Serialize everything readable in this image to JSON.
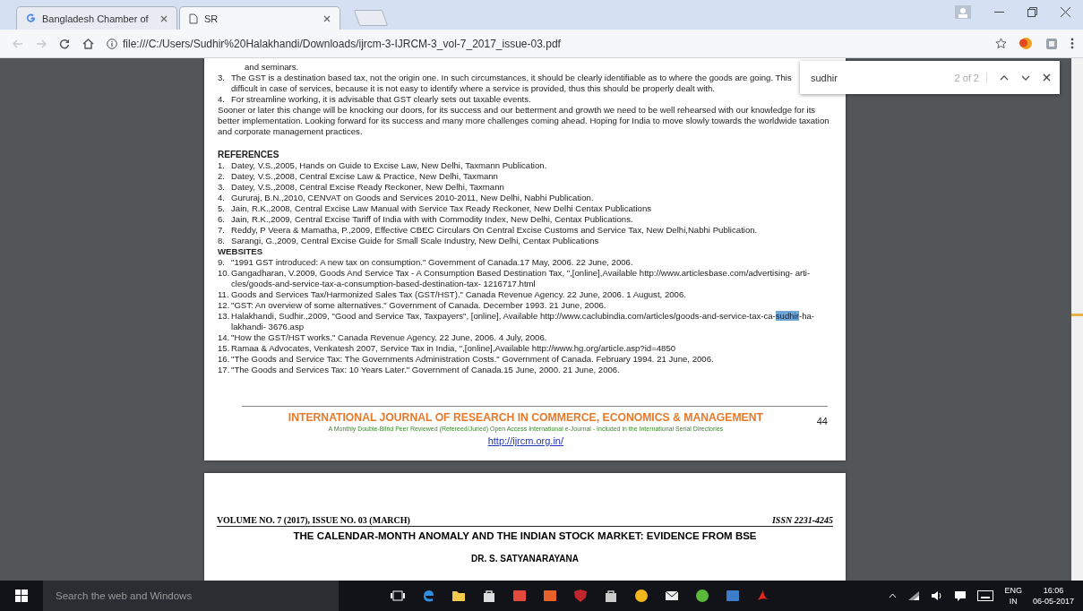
{
  "tabs": [
    {
      "title": "Bangladesh Chamber of",
      "selected": false
    },
    {
      "title": "SR",
      "selected": true
    }
  ],
  "address_bar": {
    "url": "file:///C:/Users/Sudhir%20Halakhandi/Downloads/ijrcm-3-IJRCM-3_vol-7_2017_issue-03.pdf",
    "back_disabled": true,
    "forward_disabled": true
  },
  "find_bar": {
    "query": "sudhir",
    "count": "2 of 2"
  },
  "page_1": {
    "blocks": [
      {
        "kind": "line",
        "lines": [
          "and seminars."
        ]
      },
      {
        "kind": "item",
        "number": "3.",
        "lines": [
          "The GST is a destination based tax, not the origin one. In such circumstances, it should be clearly identifiable as to where the goods are going. This",
          "difficult in case of services, because it is not easy to identify where a service is provided, thus this should be properly dealt with."
        ]
      },
      {
        "kind": "item",
        "number": "4.",
        "lines": [
          "For streamline working, it is advisable that GST clearly sets out taxable events."
        ]
      },
      {
        "kind": "paragraph",
        "lines": [
          "Sooner or later this change will be knocking our doors, for its success and our betterment and growth we need to be well rehearsed with our knowledge for its",
          "better implementation. Looking forward for its success and many more challenges coming ahead. Hoping for India to move slowly towards the worldwide taxation",
          "and corporate management practices."
        ]
      },
      {
        "kind": "heading",
        "lines": [
          "REFERENCES"
        ]
      },
      {
        "kind": "item",
        "number": "1.",
        "lines": [
          "Datey, V.S.,2005, Hands on Guide to Excise Law, New Delhi, Taxmann Publication."
        ]
      },
      {
        "kind": "item",
        "number": "2.",
        "lines": [
          "Datey, V.S.,2008, Central Excise Law & Practice, New Delhi, Taxmann"
        ]
      },
      {
        "kind": "item",
        "number": "3.",
        "lines": [
          "Datey, V.S.,2008, Central Excise Ready Reckoner, New Delhi, Taxmann"
        ]
      },
      {
        "kind": "item",
        "number": "4.",
        "lines": [
          "Gururaj, B.N.,2010, CENVAT on Goods and Services 2010-2011, New Delhi, Nabhi Publication."
        ]
      },
      {
        "kind": "item",
        "number": "5.",
        "lines": [
          "Jain, R.K.,2008, Central Excise Law Manual with Service Tax Ready Reckoner, New Delhi Centax Publications"
        ]
      },
      {
        "kind": "item",
        "number": "6.",
        "lines": [
          "Jain, R.K.,2009, Central Excise Tariff of India with with Commodity Index, New Delhi, Centax Publications."
        ]
      },
      {
        "kind": "item",
        "number": "7.",
        "lines": [
          "Reddy, P Veera & Mamatha, P.,2009, Effective CBEC Circulars On Central Excise Customs and Service Tax, New Delhi,Nabhi Publication."
        ]
      },
      {
        "kind": "item",
        "number": "8.",
        "lines": [
          "Sarangi, G.,2009, Central Excise Guide for Small Scale Industry, New Delhi, Centax Publications"
        ]
      },
      {
        "kind": "subheading",
        "lines": [
          "WEBSITES"
        ]
      },
      {
        "kind": "item",
        "number": "9.",
        "lines": [
          "\"1991 GST introduced: A new tax on consumption.\" Government of Canada.17 May, 2006. 22 June, 2006."
        ]
      },
      {
        "kind": "item",
        "number": "10.",
        "lines": [
          "Gangadharan, V.2009, Goods And Service Tax - A Consumption Based Destination Tax, \",[online],Available http://www.articlesbase.com/advertising- arti-",
          "cles/goods-and-service-tax-a-consumption-based-destination-tax- 1216717.html"
        ]
      },
      {
        "kind": "item",
        "number": "11.",
        "lines": [
          "Goods and Services Tax/Harmonized Sales Tax (GST/HST).\" Canada Revenue Agency. 22 June, 2006. 1 August, 2006."
        ]
      },
      {
        "kind": "item",
        "number": "12.",
        "lines": [
          "\"GST: An overview of some alternatives.\" Government of Canada. December 1993. 21 June, 2006."
        ]
      },
      {
        "kind": "item",
        "number": "13.",
        "lines": [
          {
            "before": "Halakhandi, Sudhir.,2009, \"Good and Service Tax, Taxpayers\", [online], Available http://www.caclubindia.com/articles/goods-and-service-tax-ca-",
            "match": "sudhir",
            "after": "-ha-"
          },
          "lakhandi- 3676.asp"
        ]
      },
      {
        "kind": "item",
        "number": "14.",
        "lines": [
          "\"How the GST/HST works.\" Canada Revenue Agency. 22 June, 2006. 4 July, 2006."
        ]
      },
      {
        "kind": "item",
        "number": "15.",
        "lines": [
          "Ramaa & Advocates, Venkatesh 2007, Service Tax in India, \",[online],Available http://www.hg.org/article.asp?id=4850"
        ]
      },
      {
        "kind": "item",
        "number": "16.",
        "lines": [
          "\"The Goods and Service Tax: The Governments Administration Costs.\" Government of Canada. February 1994. 21 June, 2006."
        ]
      },
      {
        "kind": "item",
        "number": "17.",
        "lines": [
          "\"The Goods and Services Tax: 10 Years Later.\" Government of Canada.15 June, 2000. 21 June, 2006."
        ]
      }
    ],
    "footer": {
      "journal": "INTERNATIONAL JOURNAL OF RESEARCH IN COMMERCE, ECONOMICS & MANAGEMENT",
      "subtitle": "A Monthly Double-Blind Peer Reviewed (Refereed/Juried) Open Access International e-Journal - Included in the International Serial Directories",
      "link": "http://ijrcm.org.in/",
      "page_number": "44"
    }
  },
  "page_2": {
    "volume": "VOLUME NO. 7 (2017), ISSUE NO. 03 (MARCH)",
    "issn": "ISSN 2231-4245",
    "title": "THE CALENDAR-MONTH ANOMALY AND THE INDIAN STOCK MARKET: EVIDENCE FROM BSE",
    "author": "DR. S. SATYANARAYANA"
  },
  "taskbar": {
    "search_placeholder": "Search the web and Windows",
    "language": "ENG",
    "region": "IN",
    "time": "16:06",
    "date": "06-05-2017"
  }
}
